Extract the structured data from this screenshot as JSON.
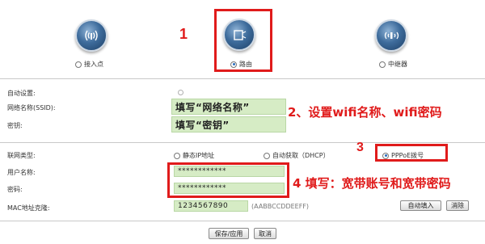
{
  "modes": [
    {
      "label": "接入点",
      "selected": false,
      "icon": "access-point-icon"
    },
    {
      "label": "路由",
      "selected": true,
      "icon": "router-icon"
    },
    {
      "label": "中继器",
      "selected": false,
      "icon": "repeater-icon"
    }
  ],
  "wifi": {
    "auto_setup_label": "自动设置:",
    "ssid_label": "网络名称(SSID):",
    "ssid_value": "填写“网络名称”",
    "password_label": "密钥:",
    "password_value": "填写“密钥”"
  },
  "wan": {
    "type_label": "联网类型:",
    "options": [
      "静态IP地址",
      "自动获取（DHCP）",
      "PPPoE拨号"
    ],
    "selected_option": "PPPoE拨号",
    "username_label": "用户名称:",
    "username_value": "************",
    "password_label": "密码:",
    "password_value": "************",
    "mac_label": "MAC地址克隆:",
    "mac_value": "1234567890",
    "mac_placeholder": "(AABBCCDDEEFF)",
    "auto_fill_label": "自动填入",
    "clear_label": "消除"
  },
  "actions": {
    "save_label": "保存/应用",
    "cancel_label": "取消"
  },
  "annotations": {
    "step1": "1",
    "step2": "2、设置wifi名称、wifi密码",
    "step3": "3",
    "step4": "4 填写：宽带账号和宽带密码"
  },
  "colors": {
    "annotation_red": "#e01b1b",
    "field_green": "#d6ecc5",
    "radio_blue": "#2c6fbf"
  }
}
